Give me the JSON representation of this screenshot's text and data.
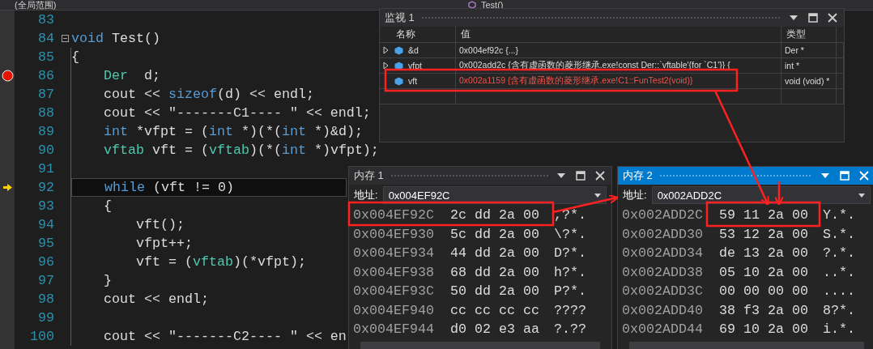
{
  "nav_bar": {
    "scope": "(全局范围)",
    "function": "Test()"
  },
  "editor": {
    "lines": [
      {
        "number": "83",
        "breakpoint": false,
        "current": false,
        "fold": false
      },
      {
        "number": "84",
        "breakpoint": false,
        "current": false,
        "fold": true,
        "tokens": [
          {
            "kind": "keyword",
            "text": "void"
          },
          {
            "kind": "plain",
            "text": " Test()"
          }
        ]
      },
      {
        "number": "85",
        "breakpoint": false,
        "current": false,
        "fold": false,
        "tokens": [
          {
            "kind": "plain",
            "text": "{"
          }
        ]
      },
      {
        "number": "86",
        "breakpoint": true,
        "current": false,
        "fold": false,
        "tokens": [
          {
            "kind": "type",
            "text": "    Der"
          },
          {
            "kind": "plain",
            "text": "  d;"
          }
        ]
      },
      {
        "number": "87",
        "breakpoint": false,
        "current": false,
        "fold": false,
        "tokens": [
          {
            "kind": "plain",
            "text": "    cout << "
          },
          {
            "kind": "keyword",
            "text": "sizeof"
          },
          {
            "kind": "plain",
            "text": "(d) << endl;"
          }
        ]
      },
      {
        "number": "88",
        "breakpoint": false,
        "current": false,
        "fold": false,
        "tokens": [
          {
            "kind": "plain",
            "text": "    cout << "
          },
          {
            "kind": "string",
            "text": "\"-------C1---- \""
          },
          {
            "kind": "plain",
            "text": " << endl;"
          }
        ]
      },
      {
        "number": "89",
        "breakpoint": false,
        "current": false,
        "fold": false,
        "tokens": [
          {
            "kind": "keyword",
            "text": "    int"
          },
          {
            "kind": "plain",
            "text": " *vfpt = ("
          },
          {
            "kind": "keyword",
            "text": "int"
          },
          {
            "kind": "plain",
            "text": " *)(*("
          },
          {
            "kind": "keyword",
            "text": "int"
          },
          {
            "kind": "plain",
            "text": " *)&d);"
          }
        ]
      },
      {
        "number": "90",
        "breakpoint": false,
        "current": false,
        "fold": false,
        "tokens": [
          {
            "kind": "type",
            "text": "    vftab"
          },
          {
            "kind": "plain",
            "text": " vft = ("
          },
          {
            "kind": "type",
            "text": "vftab"
          },
          {
            "kind": "plain",
            "text": ")(*("
          },
          {
            "kind": "keyword",
            "text": "int"
          },
          {
            "kind": "plain",
            "text": " *)vfpt);"
          }
        ]
      },
      {
        "number": "91",
        "breakpoint": false,
        "current": false,
        "fold": false
      },
      {
        "number": "92",
        "breakpoint": false,
        "current": true,
        "fold": false,
        "tokens": [
          {
            "kind": "keyword",
            "text": "    while"
          },
          {
            "kind": "plain",
            "text": " (vft != 0)"
          }
        ]
      },
      {
        "number": "93",
        "breakpoint": false,
        "current": false,
        "fold": false,
        "tokens": [
          {
            "kind": "plain",
            "text": "    {"
          }
        ]
      },
      {
        "number": "94",
        "breakpoint": false,
        "current": false,
        "fold": false,
        "tokens": [
          {
            "kind": "plain",
            "text": "        vft();"
          }
        ]
      },
      {
        "number": "95",
        "breakpoint": false,
        "current": false,
        "fold": false,
        "tokens": [
          {
            "kind": "plain",
            "text": "        vfpt++;"
          }
        ]
      },
      {
        "number": "96",
        "breakpoint": false,
        "current": false,
        "fold": false,
        "tokens": [
          {
            "kind": "plain",
            "text": "        vft = ("
          },
          {
            "kind": "type",
            "text": "vftab"
          },
          {
            "kind": "plain",
            "text": ")(*vfpt);"
          }
        ]
      },
      {
        "number": "97",
        "breakpoint": false,
        "current": false,
        "fold": false,
        "tokens": [
          {
            "kind": "plain",
            "text": "    }"
          }
        ]
      },
      {
        "number": "98",
        "breakpoint": false,
        "current": false,
        "fold": false,
        "tokens": [
          {
            "kind": "plain",
            "text": "    cout << endl;"
          }
        ]
      },
      {
        "number": "99",
        "breakpoint": false,
        "current": false,
        "fold": false
      },
      {
        "number": "100",
        "breakpoint": false,
        "current": false,
        "fold": false,
        "tokens": [
          {
            "kind": "plain",
            "text": "    cout << "
          },
          {
            "kind": "string",
            "text": "\"-------C2---- \""
          },
          {
            "kind": "plain",
            "text": " << en"
          }
        ]
      }
    ]
  },
  "watch_window": {
    "title": "监视 1",
    "columns": [
      "名称",
      "值",
      "类型"
    ],
    "rows": [
      {
        "name": "&d",
        "value": "0x004ef92c {...}",
        "type": "Der *",
        "expandable": true,
        "changed": false
      },
      {
        "name": "vfpt",
        "value": "0x002add2c {含有虚函数的菱形继承.exe!const Der::`vftable'{for `C1'}} {",
        "type": "int *",
        "expandable": true,
        "changed": false
      },
      {
        "name": "vft",
        "value": "0x002a1159 {含有虚函数的菱形继承.exe!C1::FunTest2(void)}",
        "type": "void (void) *",
        "expandable": false,
        "changed": true
      }
    ]
  },
  "memory_windows": [
    {
      "title": "内存 1",
      "active": false,
      "address_label": "地址:",
      "address": "0x004EF92C",
      "rows": [
        {
          "address": "0x004EF92C",
          "bytes": "2c dd 2a 00",
          "ascii": ",?*."
        },
        {
          "address": "0x004EF930",
          "bytes": "5c dd 2a 00",
          "ascii": "\\?*."
        },
        {
          "address": "0x004EF934",
          "bytes": "44 dd 2a 00",
          "ascii": "D?*."
        },
        {
          "address": "0x004EF938",
          "bytes": "68 dd 2a 00",
          "ascii": "h?*."
        },
        {
          "address": "0x004EF93C",
          "bytes": "50 dd 2a 00",
          "ascii": "P?*."
        },
        {
          "address": "0x004EF940",
          "bytes": "cc cc cc cc",
          "ascii": "????"
        },
        {
          "address": "0x004EF944",
          "bytes": "d0 02 e3 aa",
          "ascii": "?.??"
        }
      ]
    },
    {
      "title": "内存 2",
      "active": true,
      "address_label": "地址:",
      "address": "0x002ADD2C",
      "rows": [
        {
          "address": "0x002ADD2C",
          "bytes": "59 11 2a 00",
          "ascii": "Y.*."
        },
        {
          "address": "0x002ADD30",
          "bytes": "53 12 2a 00",
          "ascii": "S.*."
        },
        {
          "address": "0x002ADD34",
          "bytes": "de 13 2a 00",
          "ascii": "?.*."
        },
        {
          "address": "0x002ADD38",
          "bytes": "05 10 2a 00",
          "ascii": "..*."
        },
        {
          "address": "0x002ADD3C",
          "bytes": "00 00 00 00",
          "ascii": "...."
        },
        {
          "address": "0x002ADD40",
          "bytes": "38 f3 2a 00",
          "ascii": "8?*."
        },
        {
          "address": "0x002ADD44",
          "bytes": "69 10 2a 00",
          "ascii": "i.*."
        }
      ]
    }
  ]
}
